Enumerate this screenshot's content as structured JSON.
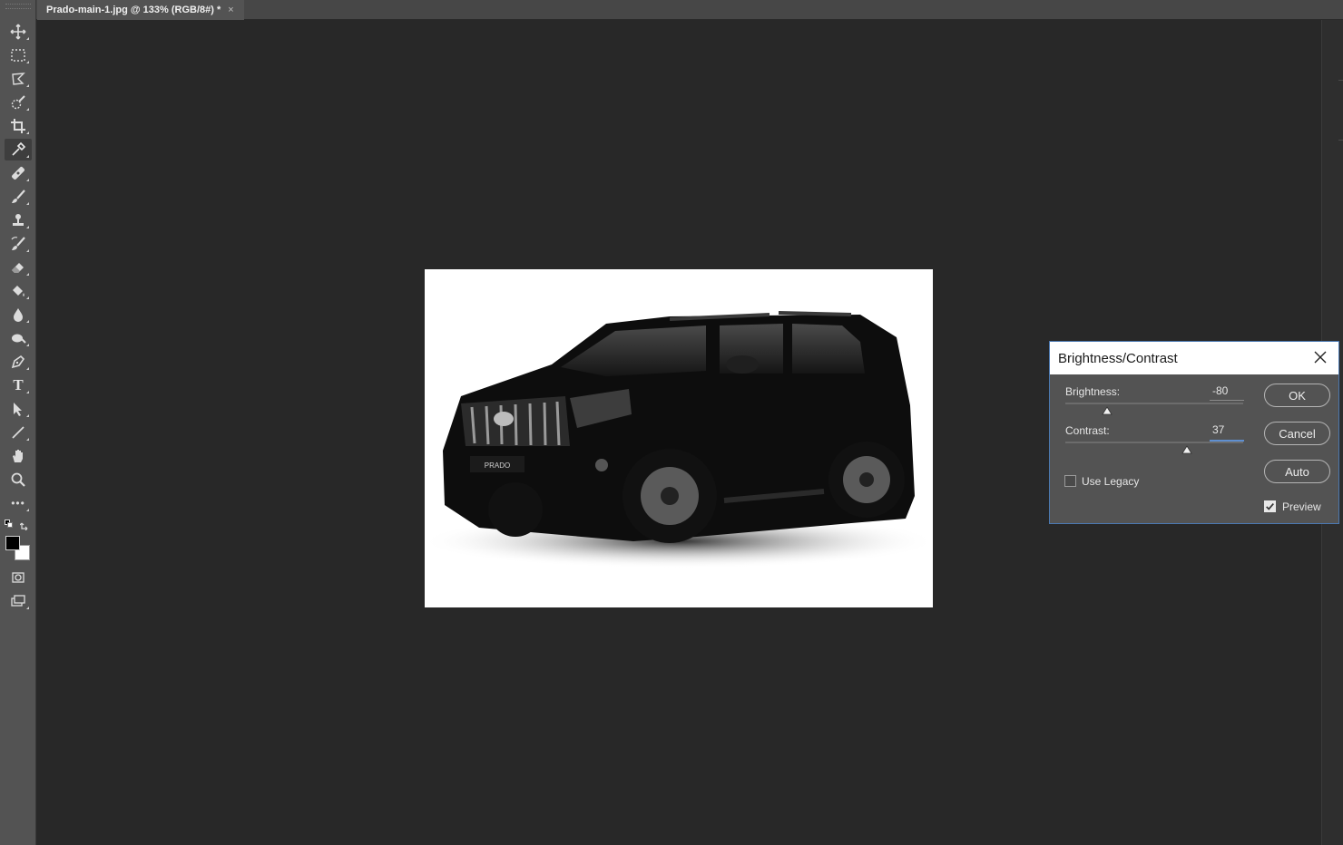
{
  "document_tab": {
    "title": "Prado-main-1.jpg @ 133% (RGB/8#) *",
    "close": "×"
  },
  "toolbar": {
    "tools": [
      "move-tool",
      "marquee-tool",
      "lasso-tool",
      "quick-selection-tool",
      "crop-tool",
      "eyedropper-tool",
      "healing-brush-tool",
      "brush-tool",
      "clone-stamp-tool",
      "history-brush-tool",
      "eraser-tool",
      "paint-bucket-tool",
      "blur-tool",
      "dodge-tool",
      "pen-tool",
      "type-tool",
      "path-selection-tool",
      "line-tool",
      "hand-tool",
      "zoom-tool",
      "more-tools"
    ],
    "active_tool": "eyedropper-tool",
    "type_glyph": "T",
    "more_glyph": "•••",
    "foreground_color": "#000000",
    "background_color": "#ffffff"
  },
  "canvas": {
    "image_description_badge": "PRADO"
  },
  "dialog": {
    "title": "Brightness/Contrast",
    "brightness_label": "Brightness:",
    "brightness_value": "-80",
    "brightness_level": -80,
    "contrast_label": "Contrast:",
    "contrast_value": "37",
    "contrast_level": 37,
    "use_legacy_label": "Use Legacy",
    "use_legacy_checked": false,
    "preview_label": "Preview",
    "preview_checked": true,
    "ok_label": "OK",
    "cancel_label": "Cancel",
    "auto_label": "Auto"
  },
  "colors": {
    "ui_panel": "#535353",
    "workspace": "#282828",
    "dialog_border_accent": "#4b78b0"
  }
}
